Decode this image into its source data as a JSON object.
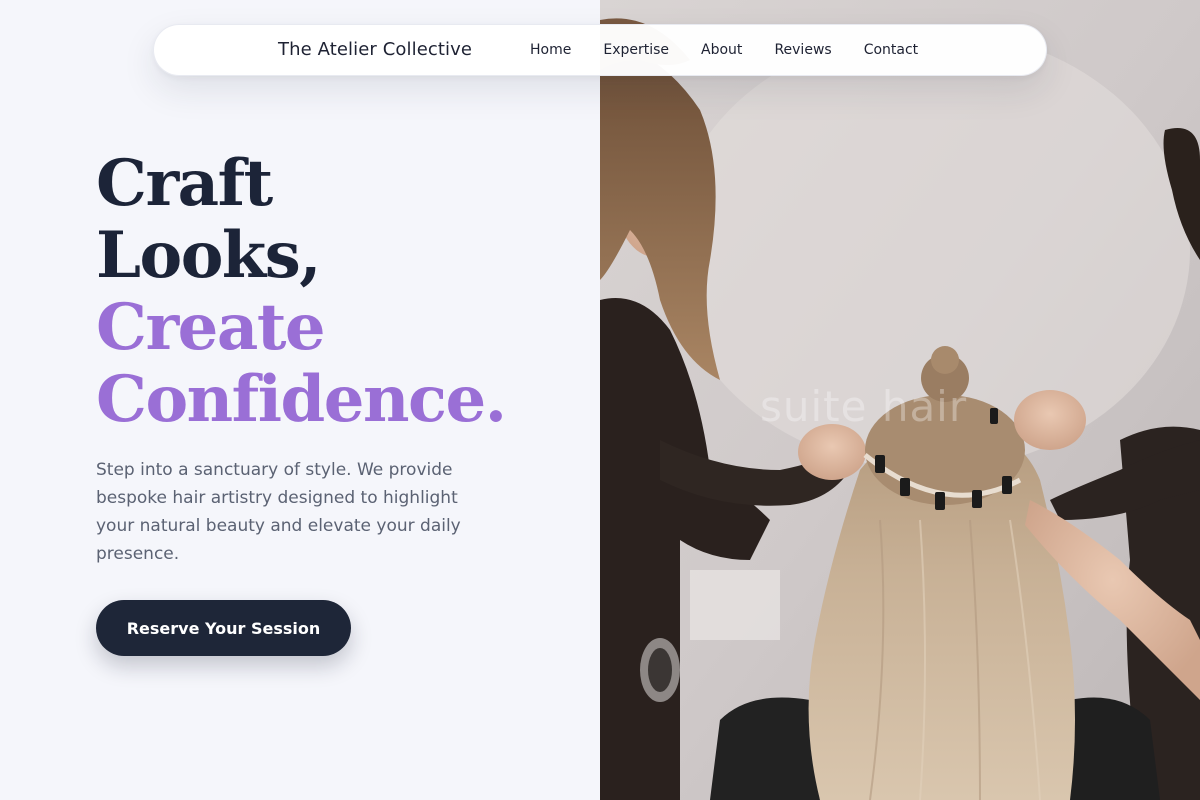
{
  "nav": {
    "brand": "The Atelier Collective",
    "links": [
      "Home",
      "Expertise",
      "About",
      "Reviews",
      "Contact"
    ]
  },
  "hero": {
    "headline": {
      "line1": "Craft",
      "line2": "Looks,",
      "line3": "Create",
      "line4": "Confidence."
    },
    "description": "Step into a sanctuary of style. We provide bespoke hair artistry designed to highlight your natural beauty and elevate your daily presence.",
    "cta_label": "Reserve Your Session"
  },
  "photo": {
    "subject": "stylists-applying-hair-extensions",
    "watermark": "suite hair"
  },
  "colors": {
    "heading_dark": "#1c2438",
    "heading_accent": "#9a6fd6",
    "body_text": "#5b6273",
    "cta_bg": "#1e2638",
    "page_bg": "#f5f6fb"
  }
}
